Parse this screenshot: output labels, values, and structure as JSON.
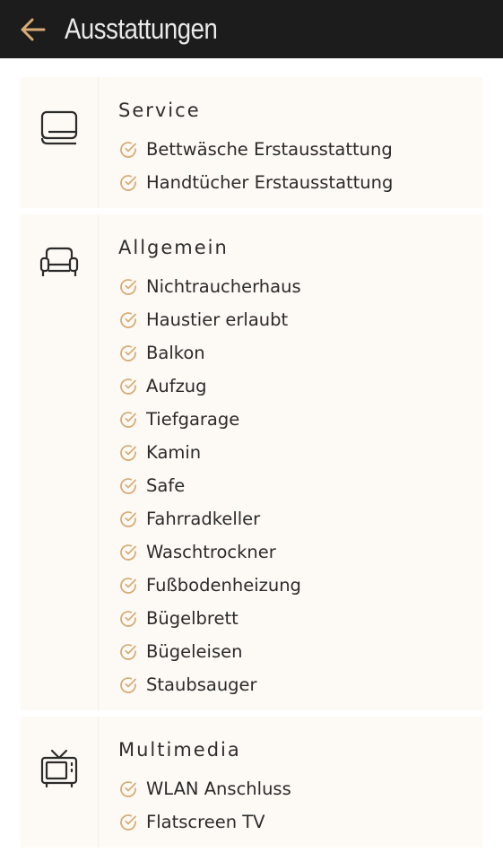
{
  "header": {
    "title": "Ausstattungen",
    "back_icon": "arrow-left-icon",
    "accent": "#d8ac77",
    "background": "#1c1c1c"
  },
  "theme": {
    "section_background": "#fdfaf5",
    "check_color": "#d8ac77"
  },
  "sections": [
    {
      "title": "Service",
      "icon": "linen-icon",
      "items": [
        "Bettwäsche Erstausstattung",
        "Handtücher Erstausstattung"
      ]
    },
    {
      "title": "Allgemein",
      "icon": "armchair-icon",
      "items": [
        "Nichtraucherhaus",
        "Haustier erlaubt",
        "Balkon",
        "Aufzug",
        "Tiefgarage",
        "Kamin",
        "Safe",
        "Fahrradkeller",
        "Waschtrockner",
        "Fußbodenheizung",
        "Bügelbrett",
        "Bügeleisen",
        "Staubsauger"
      ]
    },
    {
      "title": "Multimedia",
      "icon": "tv-icon",
      "items": [
        "WLAN Anschluss",
        "Flatscreen TV"
      ]
    }
  ]
}
